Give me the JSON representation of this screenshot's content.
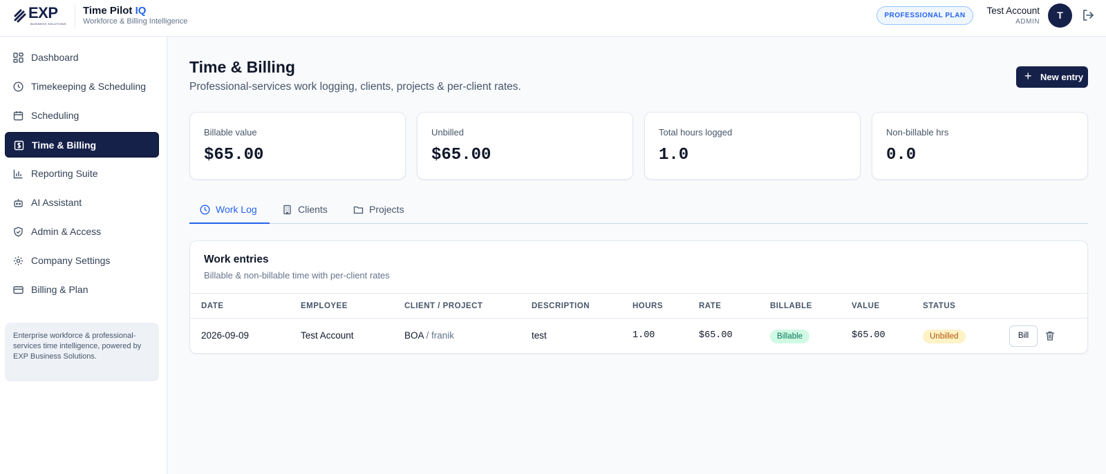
{
  "header": {
    "logo_text": "EXP",
    "logo_sub": "BUSINESS SOLUTIONS",
    "app_title": "Time Pilot",
    "app_title_accent": "IQ",
    "app_subtitle": "Workforce & Billing Intelligence",
    "plan_badge": "PROFESSIONAL PLAN",
    "account_name": "Test Account",
    "account_role": "ADMIN",
    "avatar_initial": "T"
  },
  "sidebar": {
    "items": [
      {
        "label": "Dashboard",
        "icon": "dashboard-icon"
      },
      {
        "label": "Timekeeping & Scheduling",
        "icon": "clock-icon"
      },
      {
        "label": "Scheduling",
        "icon": "calendar-icon"
      },
      {
        "label": "Time & Billing",
        "icon": "dollar-icon",
        "active": true
      },
      {
        "label": "Reporting Suite",
        "icon": "bar-chart-icon"
      },
      {
        "label": "AI Assistant",
        "icon": "bot-icon"
      },
      {
        "label": "Admin & Access",
        "icon": "shield-icon"
      },
      {
        "label": "Company Settings",
        "icon": "gear-icon"
      },
      {
        "label": "Billing & Plan",
        "icon": "credit-card-icon"
      }
    ],
    "note": "Enterprise workforce & professional-services time intelligence, powered by EXP Business Solutions."
  },
  "main": {
    "title": "Time & Billing",
    "subtitle": "Professional-services work logging, clients, projects & per-client rates.",
    "new_entry_label": "New entry",
    "stats": [
      {
        "label": "Billable value",
        "value": "$65.00"
      },
      {
        "label": "Unbilled",
        "value": "$65.00"
      },
      {
        "label": "Total hours logged",
        "value": "1.0"
      },
      {
        "label": "Non-billable hrs",
        "value": "0.0"
      }
    ],
    "tabs": [
      {
        "label": "Work Log",
        "icon": "clock-icon",
        "active": true
      },
      {
        "label": "Clients",
        "icon": "building-icon"
      },
      {
        "label": "Projects",
        "icon": "folder-icon"
      }
    ],
    "entries": {
      "title": "Work entries",
      "subtitle": "Billable & non-billable time with per-client rates",
      "columns": [
        "DATE",
        "EMPLOYEE",
        "CLIENT / PROJECT",
        "DESCRIPTION",
        "HOURS",
        "RATE",
        "BILLABLE",
        "VALUE",
        "STATUS"
      ],
      "rows": [
        {
          "date": "2026-09-09",
          "employee": "Test Account",
          "client": "BOA",
          "project": "/ franik",
          "description": "test",
          "hours": "1.00",
          "rate": "$65.00",
          "billable": "Billable",
          "value": "$65.00",
          "status": "Unbilled",
          "action_label": "Bill"
        }
      ]
    }
  },
  "colors": {
    "navy": "#16214a",
    "accent_blue": "#2563eb",
    "billable_green": "#047857",
    "unbilled_amber": "#b45309"
  }
}
